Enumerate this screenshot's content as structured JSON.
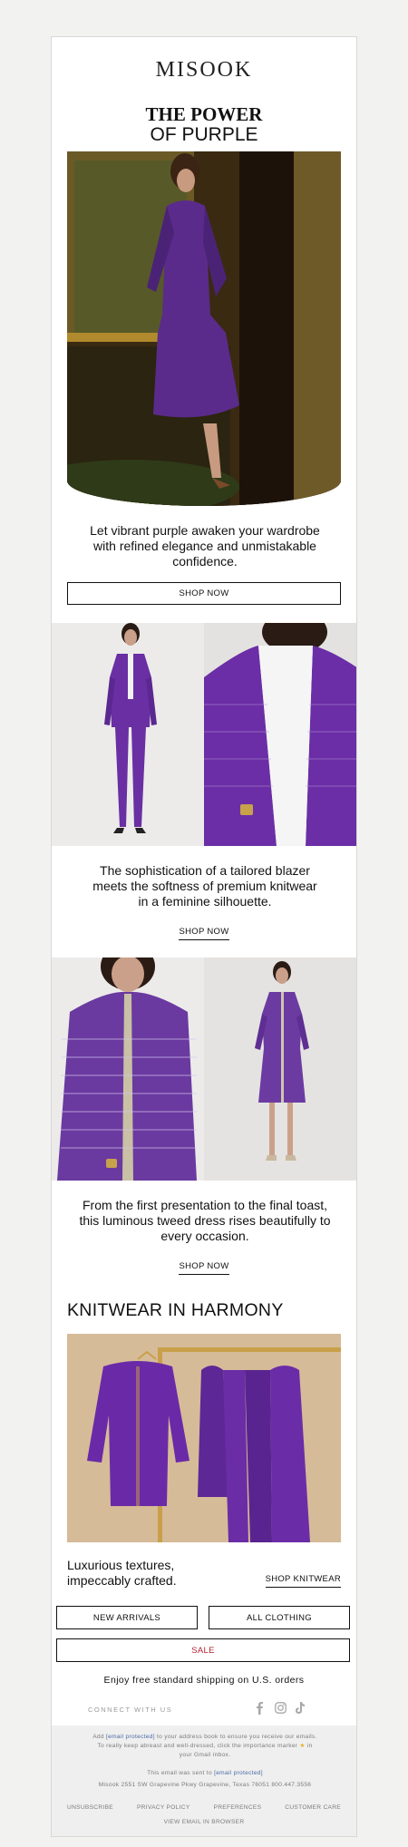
{
  "brand": {
    "logo": "MISOOK"
  },
  "hero": {
    "line1": "THE POWER",
    "line2": "OF PURPLE"
  },
  "intro": {
    "text": "Let vibrant purple awaken your wardrobe with refined elegance and unmistakable confidence.",
    "cta": "SHOP NOW"
  },
  "section2": {
    "text": "The sophistication of a tailored blazer meets the softness of premium knitwear in a feminine silhouette.",
    "cta": "SHOP NOW"
  },
  "section3": {
    "text": "From the first presentation to the final toast, this luminous tweed dress rises beautifully to every occasion.",
    "cta": "SHOP NOW"
  },
  "knitwear": {
    "title": "KNITWEAR IN HARMONY",
    "caption": "Luxurious textures, impeccably crafted.",
    "cta": "SHOP KNITWEAR"
  },
  "nav": {
    "new_arrivals": "NEW ARRIVALS",
    "all_clothing": "ALL CLOTHING",
    "sale": "SALE"
  },
  "shipping": {
    "text": "Enjoy free standard shipping on U.S. orders"
  },
  "social": {
    "label": "CONNECT WITH US",
    "icons": [
      "facebook-icon",
      "instagram-icon",
      "tiktok-icon"
    ]
  },
  "footer": {
    "line1_prefix": "Add",
    "line1_email": "[email protected]",
    "line1_suffix": "to your address book to ensure you receive our emails.",
    "line2": "To really keep abreast and well-dressed, click the importance marker",
    "line2_end": "in",
    "line3": "your Gmail inbox.",
    "sent_prefix": "This email was sent to",
    "sent_email": "[email protected]",
    "address": "Misook 2551 SW Grapevine Pkwy Grapevine, Texas 76051 800.447.3556",
    "links": [
      "UNSUBSCRIBE",
      "PRIVACY POLICY",
      "PREFERENCES",
      "CUSTOMER CARE"
    ],
    "view_browser": "VIEW EMAIL IN BROWSER"
  },
  "colors": {
    "accent_purple": "#5b2a8c",
    "sale_red": "#b22234",
    "link_blue": "#4b6aa8"
  }
}
